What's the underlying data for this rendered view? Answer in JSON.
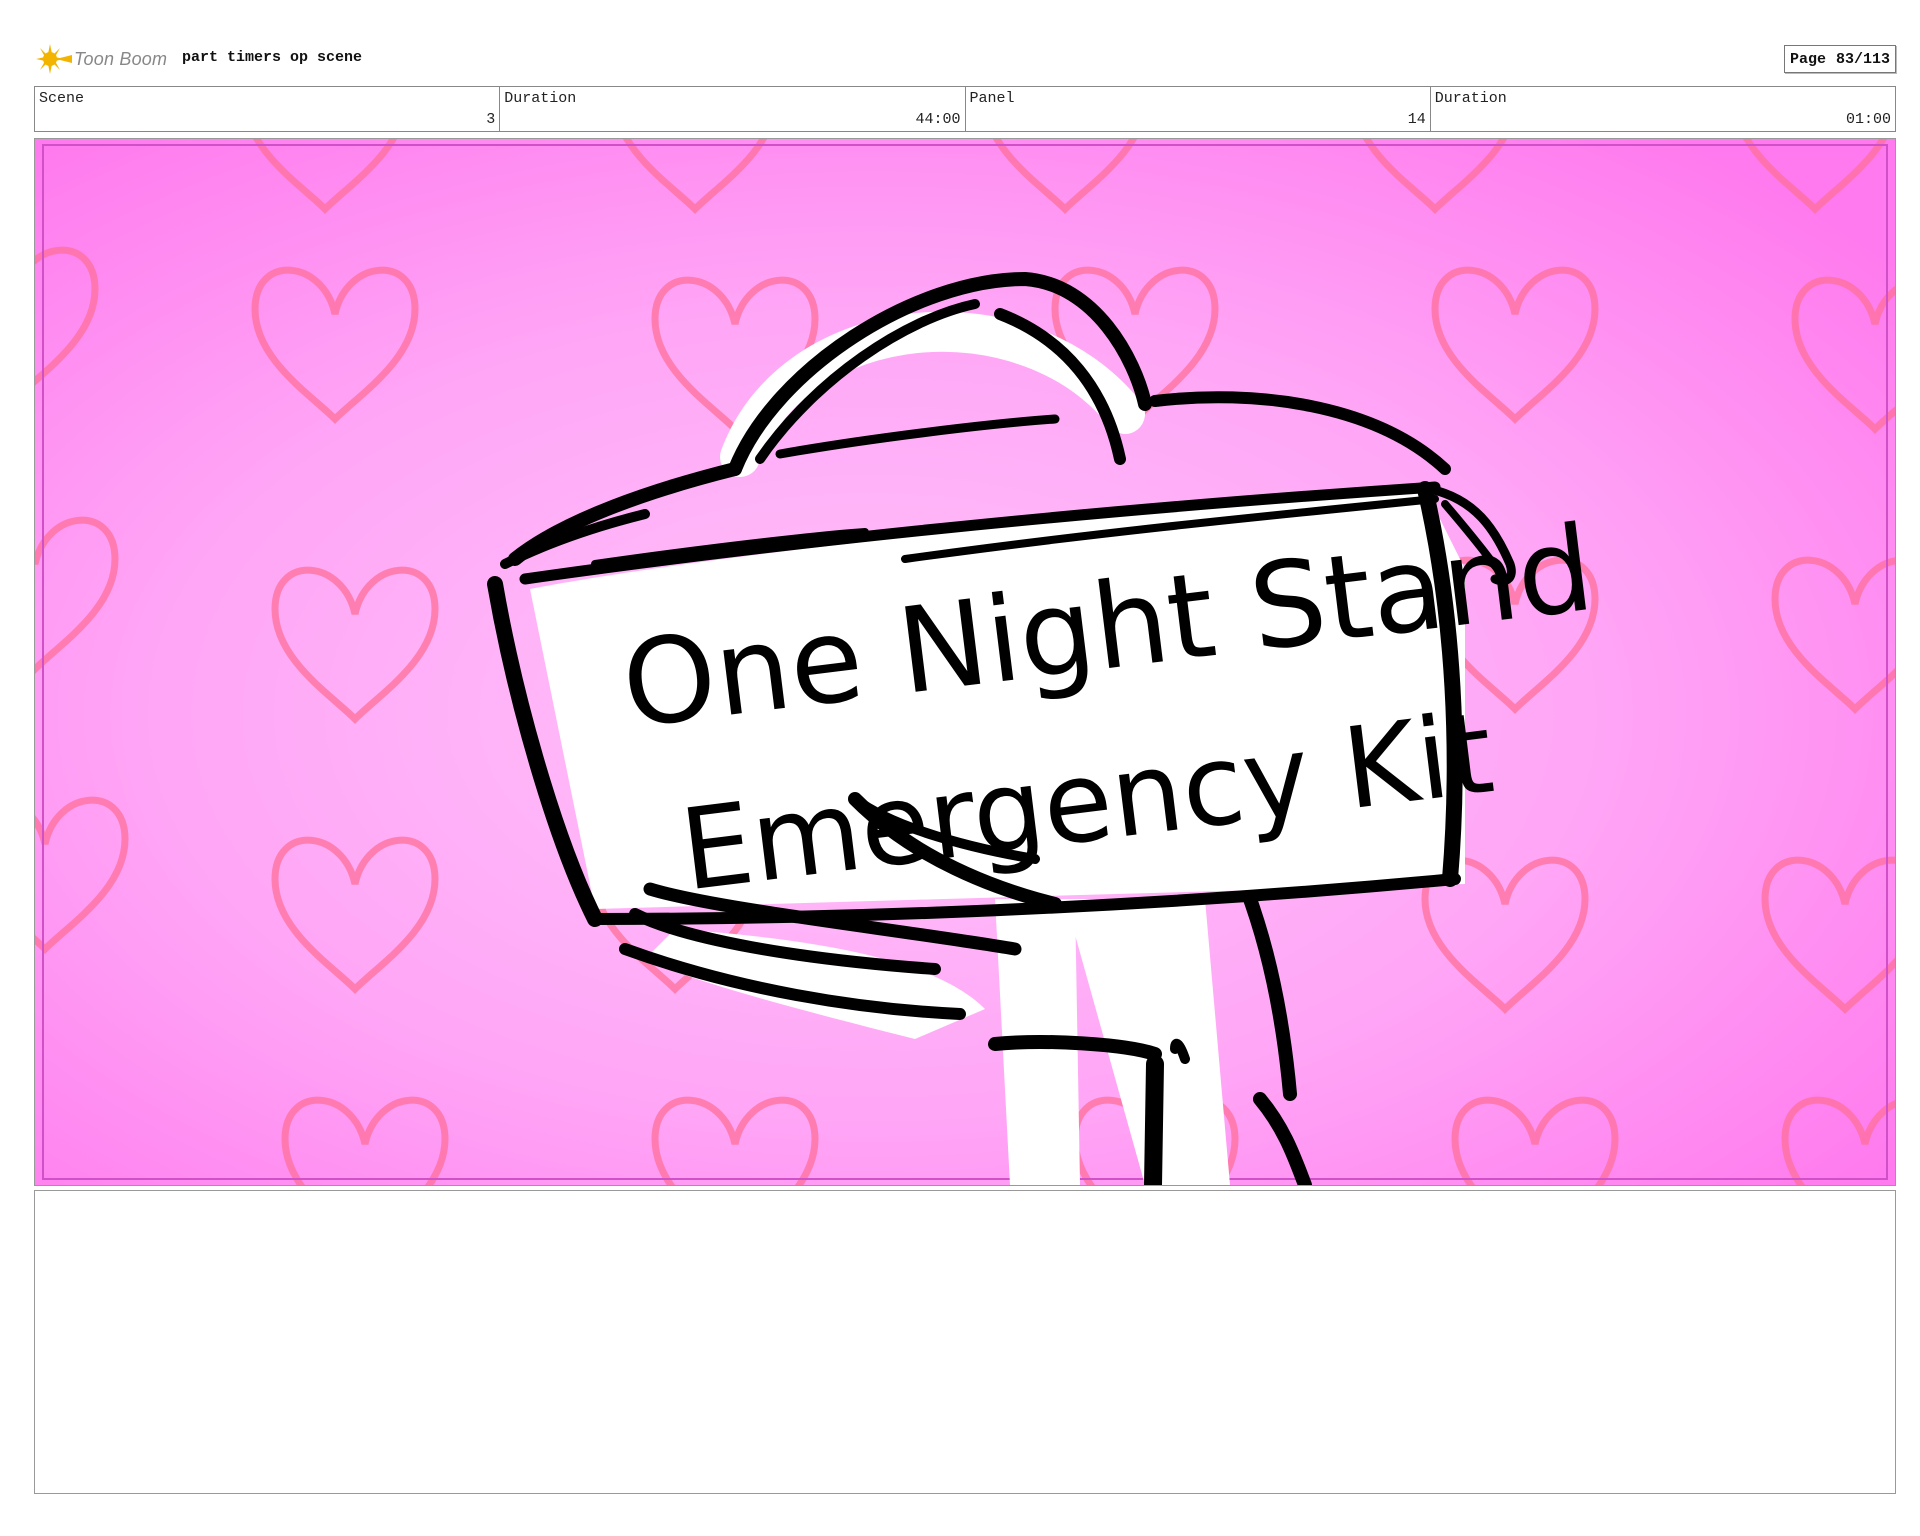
{
  "header": {
    "logo_text": "Toon Boom",
    "project_title": "part timers op scene",
    "page_label": "Page",
    "page_value": "83/113"
  },
  "info": [
    {
      "label": "Scene",
      "value": "3"
    },
    {
      "label": "Duration",
      "value": "44:00"
    },
    {
      "label": "Panel",
      "value": "14"
    },
    {
      "label": "Duration",
      "value": "01:00"
    }
  ],
  "panel": {
    "kit_line1": "One Night Stand",
    "kit_line2": "Emergency Kit",
    "background_color": "#ff8cf0",
    "heart_color": "#ff6f9a"
  },
  "notes": {
    "text": ""
  }
}
